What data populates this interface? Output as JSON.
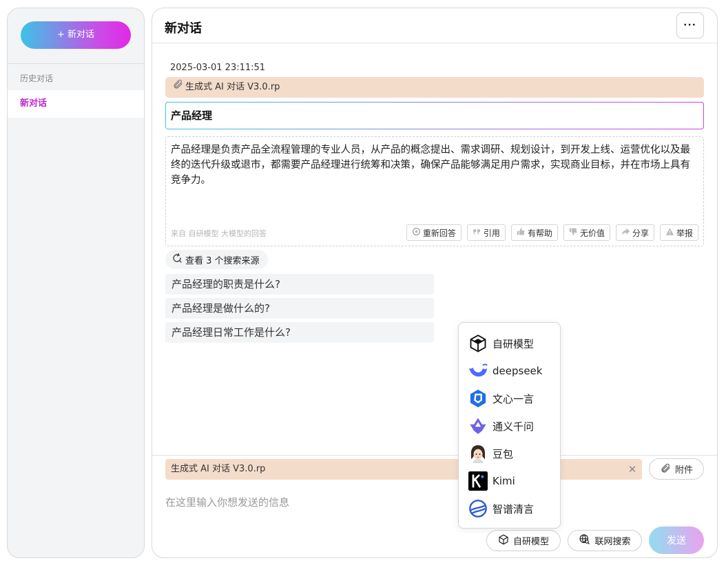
{
  "sidebar": {
    "new_chat_label": "+ 新对话",
    "history_label": "历史对话",
    "items": [
      {
        "label": "新对话"
      }
    ]
  },
  "header": {
    "title": "新对话",
    "more_label": "···"
  },
  "conversation": {
    "timestamp": "2025-03-01 23:11:51",
    "attached_file": "生成式 AI 对话 V3.0.rp",
    "question": "产品经理",
    "answer": "产品经理是负责产品全流程管理的专业人员，从产品的概念提出、需求调研、规划设计，到开发上线、运营优化以及最终的迭代升级或退市，都需要产品经理进行统筹和决策，确保产品能够满足用户需求，实现商业目标，并在市场上具有竞争力。",
    "answer_source": "来自 自研模型 大模型的回答",
    "actions": [
      {
        "label": "重新回答",
        "icon": "refresh-icon"
      },
      {
        "label": "引用",
        "icon": "quote-icon"
      },
      {
        "label": "有帮助",
        "icon": "thumbs-up-icon"
      },
      {
        "label": "无价值",
        "icon": "thumbs-down-icon"
      },
      {
        "label": "分享",
        "icon": "share-icon"
      },
      {
        "label": "举报",
        "icon": "warning-icon"
      }
    ],
    "sources_label": "查看 3 个搜索来源",
    "suggestions": [
      "产品经理的职责是什么?",
      "产品经理是做什么的?",
      "产品经理日常工作是什么?"
    ]
  },
  "model_menu": {
    "items": [
      {
        "label": "自研模型",
        "icon": "cube-icon"
      },
      {
        "label": "deepseek",
        "icon": "whale-icon"
      },
      {
        "label": "文心一言",
        "icon": "ernie-icon"
      },
      {
        "label": "通义千问",
        "icon": "tongyi-icon"
      },
      {
        "label": "豆包",
        "icon": "doubao-avatar-icon"
      },
      {
        "label": "Kimi",
        "icon": "kimi-icon"
      },
      {
        "label": "智谱清言",
        "icon": "zhipu-icon"
      }
    ]
  },
  "composer": {
    "attachment": "生成式 AI 对话 V3.0.rp",
    "attach_label": "附件",
    "placeholder": "在这里输入你想发送的信息",
    "model_label": "自研模型",
    "web_search_label": "联网搜索",
    "send_label": "发送"
  }
}
